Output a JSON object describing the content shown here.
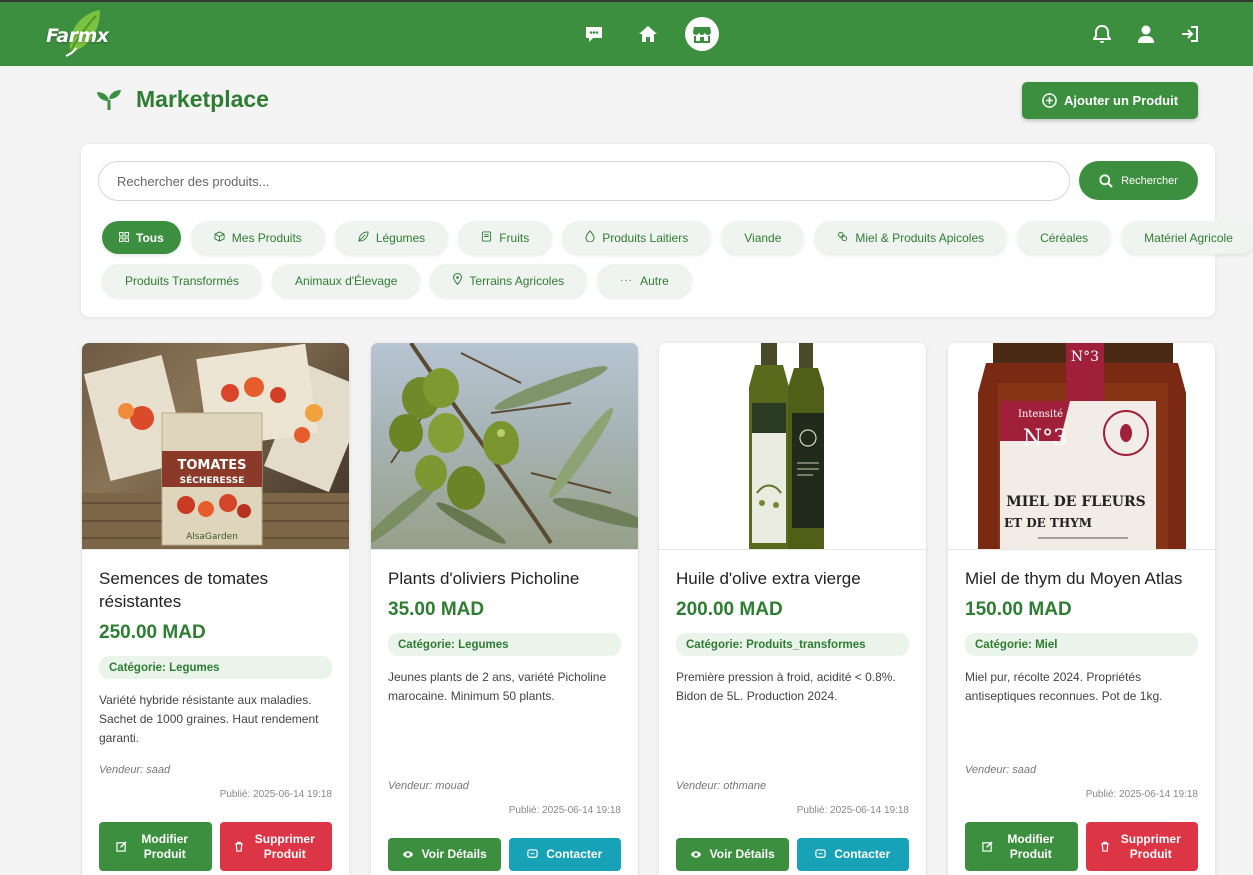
{
  "app": {
    "logo_text": "Farmx"
  },
  "nav": {
    "center_icons": [
      "chat-icon",
      "home-icon",
      "store-icon"
    ],
    "right_icons": [
      "bell-icon",
      "user-icon",
      "logout-icon"
    ],
    "active": "store-icon"
  },
  "page": {
    "title": "Marketplace",
    "add_button": "Ajouter un Produit"
  },
  "search": {
    "placeholder": "Rechercher des produits...",
    "button": "Rechercher"
  },
  "filters": [
    {
      "label": "Tous",
      "icon": "grid-icon",
      "active": true
    },
    {
      "label": "Mes Produits",
      "icon": "box-icon"
    },
    {
      "label": "Légumes",
      "icon": "leaf-icon"
    },
    {
      "label": "Fruits",
      "icon": "apple-icon"
    },
    {
      "label": "Produits Laitiers",
      "icon": "milk-icon"
    },
    {
      "label": "Viande",
      "icon": ""
    },
    {
      "label": "Miel & Produits Apicoles",
      "icon": "hive-icon"
    },
    {
      "label": "Céréales",
      "icon": ""
    },
    {
      "label": "Matériel Agricole",
      "icon": ""
    },
    {
      "label": "Produits Transformés",
      "icon": ""
    },
    {
      "label": "Animaux d'Élevage",
      "icon": ""
    },
    {
      "label": "Terrains Agricoles",
      "icon": "pin-icon"
    },
    {
      "label": "Autre",
      "icon": "dots-icon"
    }
  ],
  "products": [
    {
      "name": "Semences de tomates résistantes",
      "price": "250.00 MAD",
      "category": "Catégorie: Legumes",
      "description": "Variété hybride résistante aux maladies. Sachet de 1000 graines. Haut rendement garanti.",
      "vendor": "Vendeur: saad",
      "published": "Publié: 2025-06-14 19:18",
      "buttons": [
        "Modifier Produit",
        "Supprimer Produit"
      ],
      "image_text": [
        "TOMATES",
        "SÉCHERESSE",
        "AlsaGarden"
      ]
    },
    {
      "name": "Plants d'oliviers Picholine",
      "price": "35.00 MAD",
      "category": "Catégorie: Legumes",
      "description": "Jeunes plants de 2 ans, variété Picholine marocaine. Minimum 50 plants.",
      "vendor": "Vendeur: mouad",
      "published": "Publié: 2025-06-14 19:18",
      "buttons": [
        "Voir Détails",
        "Contacter"
      ]
    },
    {
      "name": "Huile d'olive extra vierge",
      "price": "200.00 MAD",
      "category": "Catégorie: Produits_transformes",
      "description": "Première pression à froid, acidité < 0.8%. Bidon de 5L. Production 2024.",
      "vendor": "Vendeur: othmane",
      "published": "Publié: 2025-06-14 19:18",
      "buttons": [
        "Voir Détails",
        "Contacter"
      ]
    },
    {
      "name": "Miel de thym du Moyen Atlas",
      "price": "150.00 MAD",
      "category": "Catégorie: Miel",
      "description": "Miel pur, récolte 2024. Propriétés antiseptiques reconnues. Pot de 1kg.",
      "vendor": "Vendeur: saad",
      "published": "Publié: 2025-06-14 19:18",
      "buttons": [
        "Modifier Produit",
        "Supprimer Produit"
      ],
      "image_text": [
        "N°3",
        "Intensité",
        "MIEL DE FLEURS",
        "ET DE THYM"
      ]
    }
  ],
  "colors": {
    "brand": "#3c8f3f",
    "danger": "#dc3545",
    "info": "#17a2b8"
  }
}
